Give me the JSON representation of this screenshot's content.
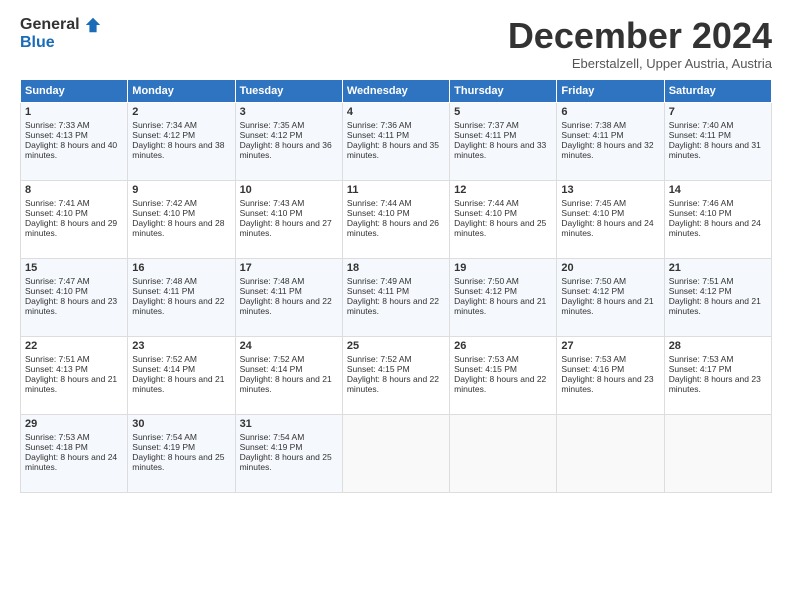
{
  "logo": {
    "general": "General",
    "blue": "Blue"
  },
  "header": {
    "month": "December 2024",
    "location": "Eberstalzell, Upper Austria, Austria"
  },
  "days": [
    "Sunday",
    "Monday",
    "Tuesday",
    "Wednesday",
    "Thursday",
    "Friday",
    "Saturday"
  ],
  "weeks": [
    [
      {
        "day": "1",
        "sunrise": "7:33 AM",
        "sunset": "4:13 PM",
        "daylight": "8 hours and 40 minutes."
      },
      {
        "day": "2",
        "sunrise": "7:34 AM",
        "sunset": "4:12 PM",
        "daylight": "8 hours and 38 minutes."
      },
      {
        "day": "3",
        "sunrise": "7:35 AM",
        "sunset": "4:12 PM",
        "daylight": "8 hours and 36 minutes."
      },
      {
        "day": "4",
        "sunrise": "7:36 AM",
        "sunset": "4:11 PM",
        "daylight": "8 hours and 35 minutes."
      },
      {
        "day": "5",
        "sunrise": "7:37 AM",
        "sunset": "4:11 PM",
        "daylight": "8 hours and 33 minutes."
      },
      {
        "day": "6",
        "sunrise": "7:38 AM",
        "sunset": "4:11 PM",
        "daylight": "8 hours and 32 minutes."
      },
      {
        "day": "7",
        "sunrise": "7:40 AM",
        "sunset": "4:11 PM",
        "daylight": "8 hours and 31 minutes."
      }
    ],
    [
      {
        "day": "8",
        "sunrise": "7:41 AM",
        "sunset": "4:10 PM",
        "daylight": "8 hours and 29 minutes."
      },
      {
        "day": "9",
        "sunrise": "7:42 AM",
        "sunset": "4:10 PM",
        "daylight": "8 hours and 28 minutes."
      },
      {
        "day": "10",
        "sunrise": "7:43 AM",
        "sunset": "4:10 PM",
        "daylight": "8 hours and 27 minutes."
      },
      {
        "day": "11",
        "sunrise": "7:44 AM",
        "sunset": "4:10 PM",
        "daylight": "8 hours and 26 minutes."
      },
      {
        "day": "12",
        "sunrise": "7:44 AM",
        "sunset": "4:10 PM",
        "daylight": "8 hours and 25 minutes."
      },
      {
        "day": "13",
        "sunrise": "7:45 AM",
        "sunset": "4:10 PM",
        "daylight": "8 hours and 24 minutes."
      },
      {
        "day": "14",
        "sunrise": "7:46 AM",
        "sunset": "4:10 PM",
        "daylight": "8 hours and 24 minutes."
      }
    ],
    [
      {
        "day": "15",
        "sunrise": "7:47 AM",
        "sunset": "4:10 PM",
        "daylight": "8 hours and 23 minutes."
      },
      {
        "day": "16",
        "sunrise": "7:48 AM",
        "sunset": "4:11 PM",
        "daylight": "8 hours and 22 minutes."
      },
      {
        "day": "17",
        "sunrise": "7:48 AM",
        "sunset": "4:11 PM",
        "daylight": "8 hours and 22 minutes."
      },
      {
        "day": "18",
        "sunrise": "7:49 AM",
        "sunset": "4:11 PM",
        "daylight": "8 hours and 22 minutes."
      },
      {
        "day": "19",
        "sunrise": "7:50 AM",
        "sunset": "4:12 PM",
        "daylight": "8 hours and 21 minutes."
      },
      {
        "day": "20",
        "sunrise": "7:50 AM",
        "sunset": "4:12 PM",
        "daylight": "8 hours and 21 minutes."
      },
      {
        "day": "21",
        "sunrise": "7:51 AM",
        "sunset": "4:12 PM",
        "daylight": "8 hours and 21 minutes."
      }
    ],
    [
      {
        "day": "22",
        "sunrise": "7:51 AM",
        "sunset": "4:13 PM",
        "daylight": "8 hours and 21 minutes."
      },
      {
        "day": "23",
        "sunrise": "7:52 AM",
        "sunset": "4:14 PM",
        "daylight": "8 hours and 21 minutes."
      },
      {
        "day": "24",
        "sunrise": "7:52 AM",
        "sunset": "4:14 PM",
        "daylight": "8 hours and 21 minutes."
      },
      {
        "day": "25",
        "sunrise": "7:52 AM",
        "sunset": "4:15 PM",
        "daylight": "8 hours and 22 minutes."
      },
      {
        "day": "26",
        "sunrise": "7:53 AM",
        "sunset": "4:15 PM",
        "daylight": "8 hours and 22 minutes."
      },
      {
        "day": "27",
        "sunrise": "7:53 AM",
        "sunset": "4:16 PM",
        "daylight": "8 hours and 23 minutes."
      },
      {
        "day": "28",
        "sunrise": "7:53 AM",
        "sunset": "4:17 PM",
        "daylight": "8 hours and 23 minutes."
      }
    ],
    [
      {
        "day": "29",
        "sunrise": "7:53 AM",
        "sunset": "4:18 PM",
        "daylight": "8 hours and 24 minutes."
      },
      {
        "day": "30",
        "sunrise": "7:54 AM",
        "sunset": "4:19 PM",
        "daylight": "8 hours and 25 minutes."
      },
      {
        "day": "31",
        "sunrise": "7:54 AM",
        "sunset": "4:19 PM",
        "daylight": "8 hours and 25 minutes."
      },
      null,
      null,
      null,
      null
    ]
  ]
}
